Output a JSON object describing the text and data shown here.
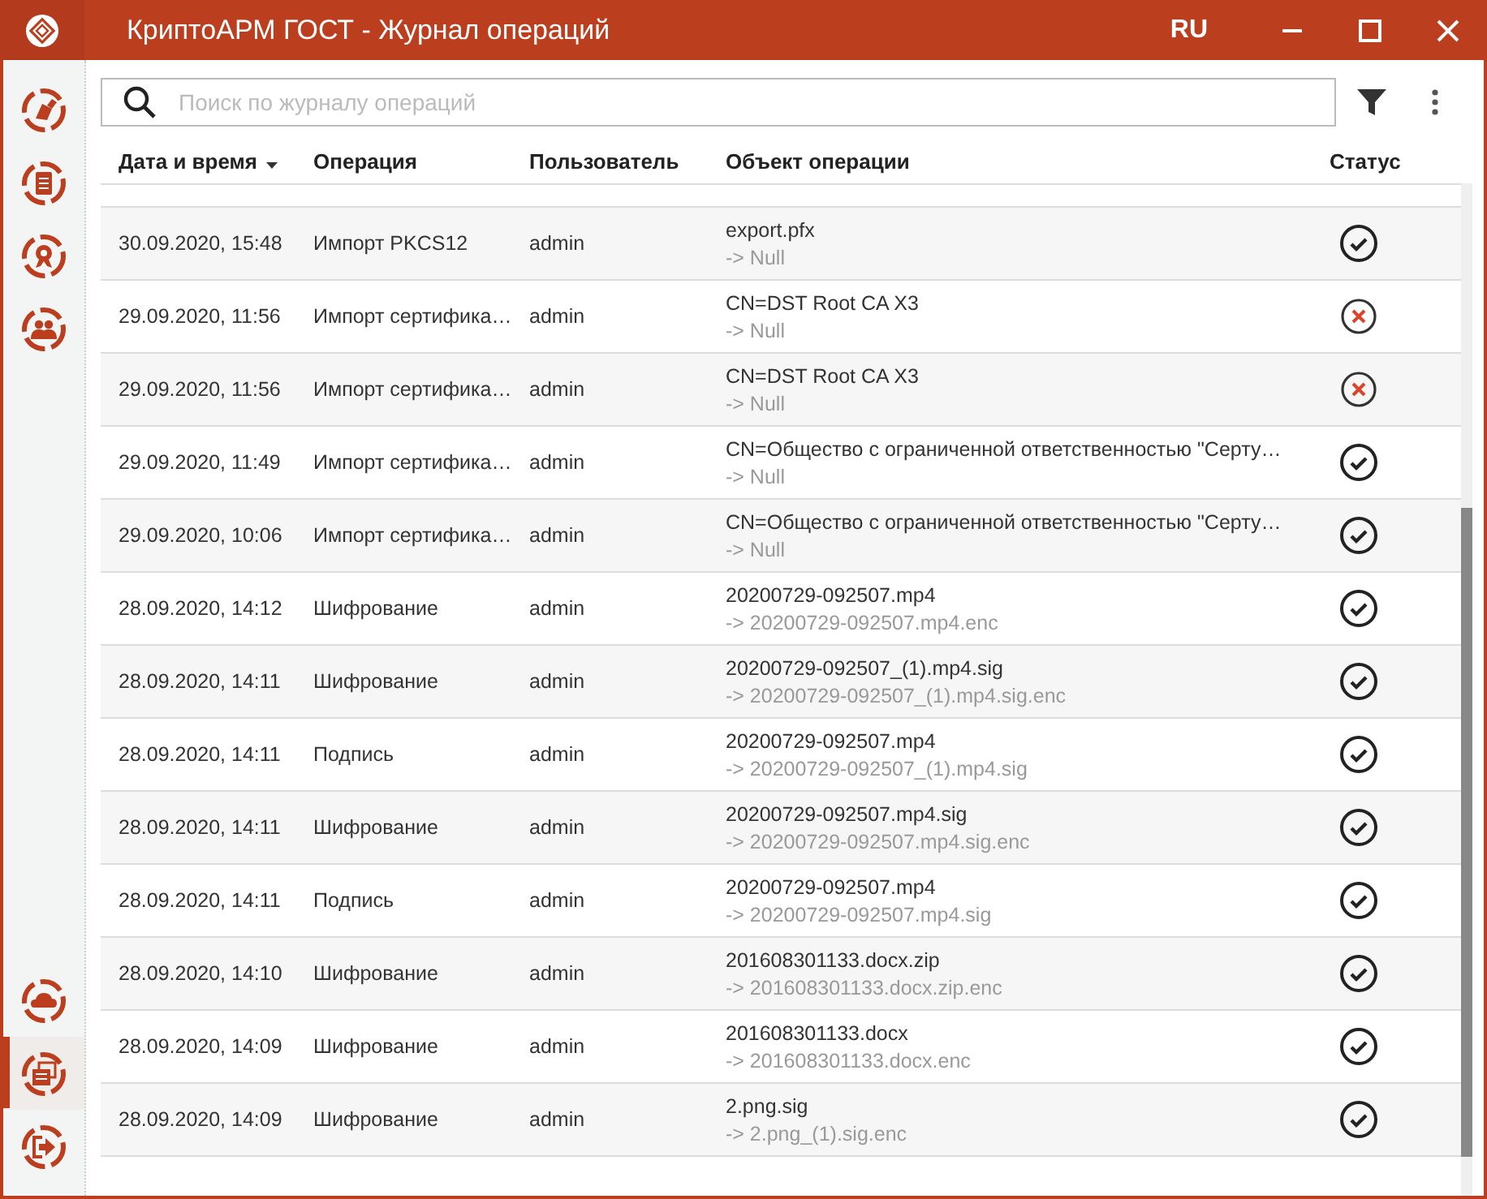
{
  "window": {
    "title": "КриптоАРМ ГОСТ - Журнал операций",
    "language": "RU"
  },
  "sidebar": {
    "top_items": [
      {
        "selected": false
      },
      {
        "selected": false
      },
      {
        "selected": false
      },
      {
        "selected": false
      }
    ],
    "bottom_items": [
      {
        "selected": false
      },
      {
        "selected": true
      },
      {
        "selected": false
      }
    ]
  },
  "search": {
    "placeholder": "Поиск по журналу операций"
  },
  "table": {
    "columns": [
      {
        "label": "Дата и время",
        "sorted": true
      },
      {
        "label": "Операция",
        "sorted": false
      },
      {
        "label": "Пользователь",
        "sorted": false
      },
      {
        "label": "Объект операции",
        "sorted": false
      },
      {
        "label": "Статус",
        "sorted": false
      }
    ],
    "rows": [
      {
        "date": "30.09.2020, 15:48",
        "operation": "Импорт PKCS12",
        "user": "admin",
        "object": "export.pfx",
        "result": "-> Null",
        "success": true
      },
      {
        "date": "29.09.2020, 11:56",
        "operation": "Импорт сертифика…",
        "user": "admin",
        "object": "CN=DST Root CA X3",
        "result": "-> Null",
        "success": false
      },
      {
        "date": "29.09.2020, 11:56",
        "operation": "Импорт сертифика…",
        "user": "admin",
        "object": "CN=DST Root CA X3",
        "result": "-> Null",
        "success": false
      },
      {
        "date": "29.09.2020, 11:49",
        "operation": "Импорт сертифика…",
        "user": "admin",
        "object": "CN=Общество с ограниченной ответственностью \"Серту…",
        "result": "-> Null",
        "success": true
      },
      {
        "date": "29.09.2020, 10:06",
        "operation": "Импорт сертифика…",
        "user": "admin",
        "object": "CN=Общество с ограниченной ответственностью \"Серту…",
        "result": "-> Null",
        "success": true
      },
      {
        "date": "28.09.2020, 14:12",
        "operation": "Шифрование",
        "user": "admin",
        "object": "20200729-092507.mp4",
        "result": "-> 20200729-092507.mp4.enc",
        "success": true
      },
      {
        "date": "28.09.2020, 14:11",
        "operation": "Шифрование",
        "user": "admin",
        "object": "20200729-092507_(1).mp4.sig",
        "result": "-> 20200729-092507_(1).mp4.sig.enc",
        "success": true
      },
      {
        "date": "28.09.2020, 14:11",
        "operation": "Подпись",
        "user": "admin",
        "object": "20200729-092507.mp4",
        "result": "-> 20200729-092507_(1).mp4.sig",
        "success": true
      },
      {
        "date": "28.09.2020, 14:11",
        "operation": "Шифрование",
        "user": "admin",
        "object": "20200729-092507.mp4.sig",
        "result": "-> 20200729-092507.mp4.sig.enc",
        "success": true
      },
      {
        "date": "28.09.2020, 14:11",
        "operation": "Подпись",
        "user": "admin",
        "object": "20200729-092507.mp4",
        "result": "-> 20200729-092507.mp4.sig",
        "success": true
      },
      {
        "date": "28.09.2020, 14:10",
        "operation": "Шифрование",
        "user": "admin",
        "object": "201608301133.docx.zip",
        "result": "-> 201608301133.docx.zip.enc",
        "success": true
      },
      {
        "date": "28.09.2020, 14:09",
        "operation": "Шифрование",
        "user": "admin",
        "object": "201608301133.docx",
        "result": "-> 201608301133.docx.enc",
        "success": true
      },
      {
        "date": "28.09.2020, 14:09",
        "operation": "Шифрование",
        "user": "admin",
        "object": "2.png.sig",
        "result": "-> 2.png_(1).sig.enc",
        "success": true
      }
    ]
  }
}
